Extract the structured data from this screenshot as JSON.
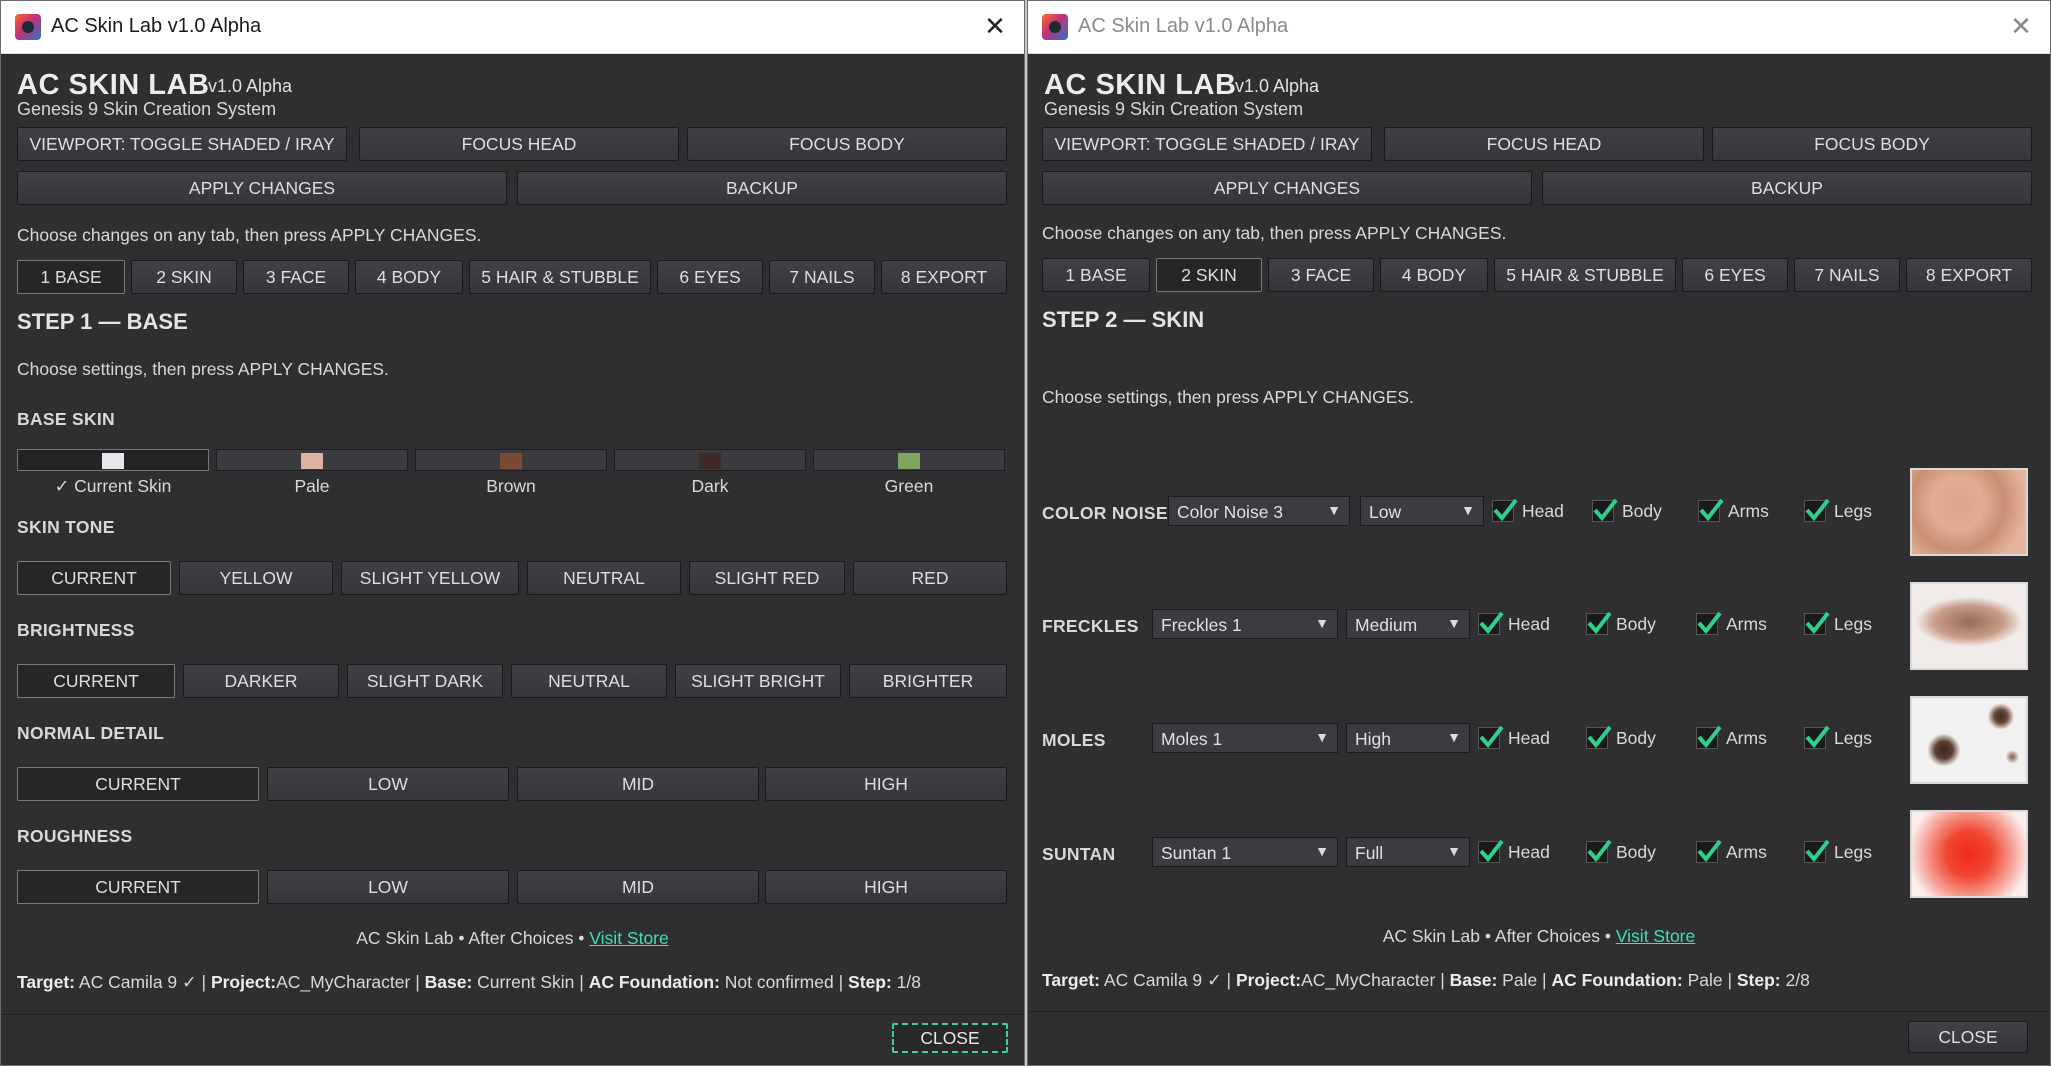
{
  "colors": {
    "accent_link": "#3fe0b0",
    "window_bg": "#2f2f31",
    "focus_border": "#3fcf9a"
  },
  "left": {
    "window_title": "AC Skin Lab v1.0 Alpha",
    "app_title": "AC SKIN LAB",
    "app_version": "v1.0 Alpha",
    "app_subtitle": "Genesis 9 Skin Creation System",
    "toolbar": {
      "viewport": "VIEWPORT: TOGGLE SHADED / IRAY",
      "focus_head": "FOCUS HEAD",
      "focus_body": "FOCUS BODY",
      "apply": "APPLY CHANGES",
      "backup": "BACKUP"
    },
    "hint": "Choose changes on any tab, then press APPLY CHANGES.",
    "tabs": [
      "1 BASE",
      "2 SKIN",
      "3 FACE",
      "4 BODY",
      "5 HAIR & STUBBLE",
      "6 EYES",
      "7 NAILS",
      "8 EXPORT"
    ],
    "active_tab": "1 BASE",
    "step_title": "STEP 1 — BASE",
    "step_hint": "Choose settings, then press APPLY CHANGES.",
    "base_skin": {
      "label": "BASE SKIN",
      "options": [
        {
          "label": "✓ Current Skin",
          "color": "#e6e9ec"
        },
        {
          "label": "Pale",
          "color": "#d9b39f"
        },
        {
          "label": "Brown",
          "color": "#7a4a34"
        },
        {
          "label": "Dark",
          "color": "#3e2a24"
        },
        {
          "label": "Green",
          "color": "#7ea65e"
        }
      ]
    },
    "skin_tone": {
      "label": "SKIN TONE",
      "options": [
        "CURRENT",
        "YELLOW",
        "SLIGHT YELLOW",
        "NEUTRAL",
        "SLIGHT RED",
        "RED"
      ]
    },
    "brightness": {
      "label": "BRIGHTNESS",
      "options": [
        "CURRENT",
        "DARKER",
        "SLIGHT DARK",
        "NEUTRAL",
        "SLIGHT BRIGHT",
        "BRIGHTER"
      ]
    },
    "normal_detail": {
      "label": "NORMAL DETAIL",
      "options": [
        "CURRENT",
        "LOW",
        "MID",
        "HIGH"
      ]
    },
    "roughness": {
      "label": "ROUGHNESS",
      "options": [
        "CURRENT",
        "LOW",
        "MID",
        "HIGH"
      ]
    },
    "footer": {
      "credit": "AC Skin Lab • After Choices •",
      "store_link": "Visit Store"
    },
    "status": {
      "target_k": "Target:",
      "target_v": "AC Camila 9 ✓",
      "project_k": "Project:",
      "project_v": "AC_MyCharacter",
      "base_k": "Base:",
      "base_v": "Current Skin",
      "foundation_k": "AC Foundation:",
      "foundation_v": "Not confirmed",
      "step_k": "Step:",
      "step_v": "1/8"
    },
    "close": "CLOSE"
  },
  "right": {
    "window_title": "AC Skin Lab v1.0 Alpha",
    "app_title": "AC SKIN LAB",
    "app_version": "v1.0 Alpha",
    "app_subtitle": "Genesis 9 Skin Creation System",
    "toolbar": {
      "viewport": "VIEWPORT: TOGGLE SHADED / IRAY",
      "focus_head": "FOCUS HEAD",
      "focus_body": "FOCUS BODY",
      "apply": "APPLY CHANGES",
      "backup": "BACKUP"
    },
    "hint": "Choose changes on any tab, then press APPLY CHANGES.",
    "tabs": [
      "1 BASE",
      "2 SKIN",
      "3 FACE",
      "4 BODY",
      "5 HAIR & STUBBLE",
      "6 EYES",
      "7 NAILS",
      "8 EXPORT"
    ],
    "active_tab": "2 SKIN",
    "step_title": "STEP 2 — SKIN",
    "step_hint": "Choose settings, then press APPLY CHANGES.",
    "rows": [
      {
        "label": "COLOR NOISE",
        "preset": "Color Noise 3",
        "level": "Low",
        "checks": [
          "Head",
          "Body",
          "Arms",
          "Legs"
        ]
      },
      {
        "label": "FRECKLES",
        "preset": "Freckles 1",
        "level": "Medium",
        "checks": [
          "Head",
          "Body",
          "Arms",
          "Legs"
        ]
      },
      {
        "label": "MOLES",
        "preset": "Moles 1",
        "level": "High",
        "checks": [
          "Head",
          "Body",
          "Arms",
          "Legs"
        ]
      },
      {
        "label": "SUNTAN",
        "preset": "Suntan 1",
        "level": "Full",
        "checks": [
          "Head",
          "Body",
          "Arms",
          "Legs"
        ]
      }
    ],
    "footer": {
      "credit": "AC Skin Lab • After Choices •",
      "store_link": "Visit Store"
    },
    "status": {
      "target_k": "Target:",
      "target_v": "AC Camila 9 ✓",
      "project_k": "Project:",
      "project_v": "AC_MyCharacter",
      "base_k": "Base:",
      "base_v": "Pale",
      "foundation_k": "AC Foundation:",
      "foundation_v": "Pale",
      "step_k": "Step:",
      "step_v": "2/8"
    },
    "close": "CLOSE"
  }
}
